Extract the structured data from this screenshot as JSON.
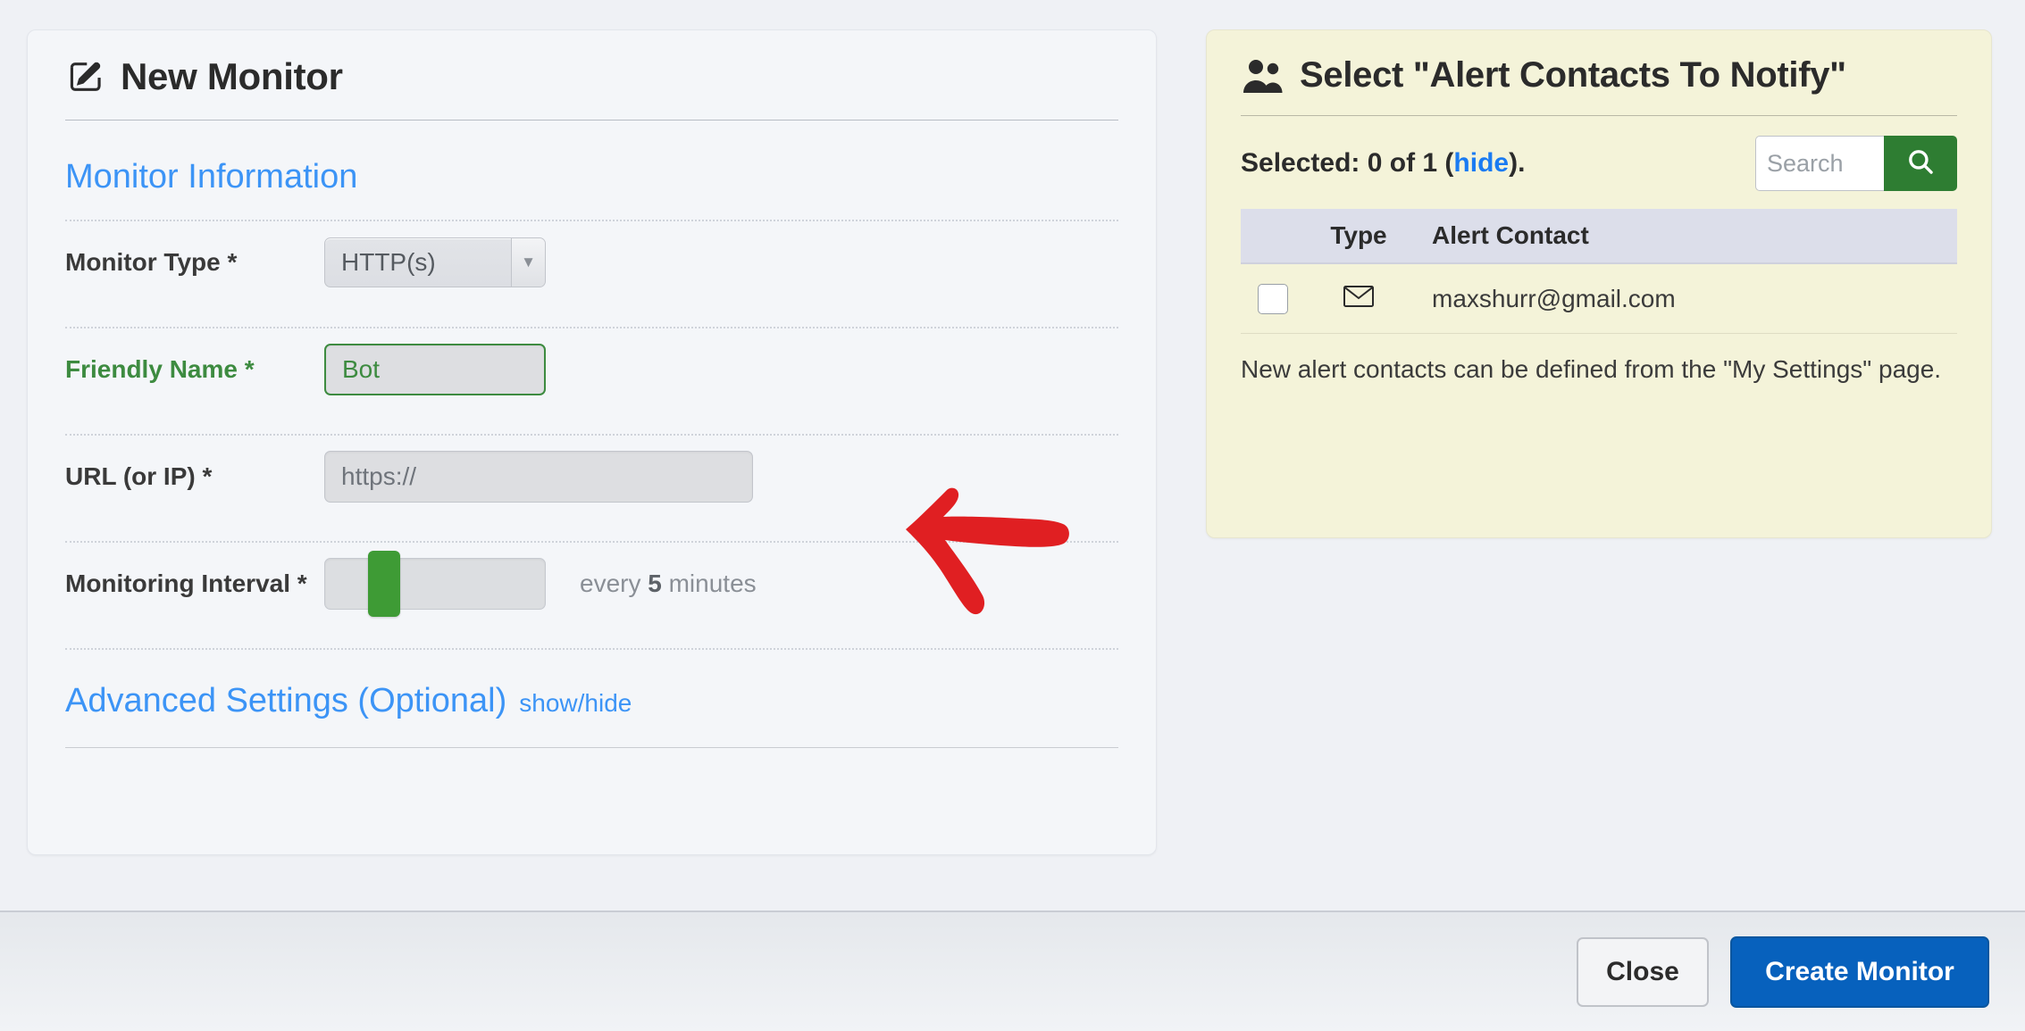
{
  "left_card": {
    "header": {
      "icon": "edit-pencil-icon",
      "title": "New Monitor"
    },
    "section_title": "Monitor Information",
    "fields": {
      "monitor_type": {
        "label": "Monitor Type *",
        "value": "HTTP(s)",
        "dropdown_icon": "chevron-down-icon"
      },
      "friendly_name": {
        "label": "Friendly Name *",
        "value": "Bot"
      },
      "url": {
        "label": "URL (or IP) *",
        "placeholder": "https://",
        "value": ""
      },
      "monitoring_interval": {
        "label": "Monitoring Interval *",
        "caption_prefix": "every ",
        "caption_value": "5",
        "caption_suffix": " minutes",
        "slider_value": 5
      }
    },
    "advanced": {
      "title": "Advanced Settings (Optional)",
      "toggle": "show/hide"
    }
  },
  "right_panel": {
    "icon": "users-icon",
    "title": "Select \"Alert Contacts To Notify\"",
    "selected_text_prefix": "Selected: 0 of 1 (",
    "selected_link": "hide",
    "selected_text_suffix": ").",
    "search": {
      "placeholder": "Search",
      "value": "",
      "button_icon": "search-icon"
    },
    "table": {
      "columns": [
        "",
        "Type",
        "Alert Contact"
      ],
      "rows": [
        {
          "checked": false,
          "type_icon": "envelope-icon",
          "contact": "maxshurr@gmail.com"
        }
      ]
    },
    "note": "New alert contacts can be defined from the \"My Settings\" page."
  },
  "footer": {
    "close_label": "Close",
    "create_label": "Create Monitor"
  },
  "annotation": {
    "type": "red-arrow-left",
    "color": "#e01f22",
    "points_to": "url-input"
  },
  "colors": {
    "accent_blue": "#3c94f6",
    "primary_button": "#0761bd",
    "success_green": "#3d8b40",
    "panel_yellow": "#f4f3d9",
    "annotation_red": "#e01f22"
  }
}
